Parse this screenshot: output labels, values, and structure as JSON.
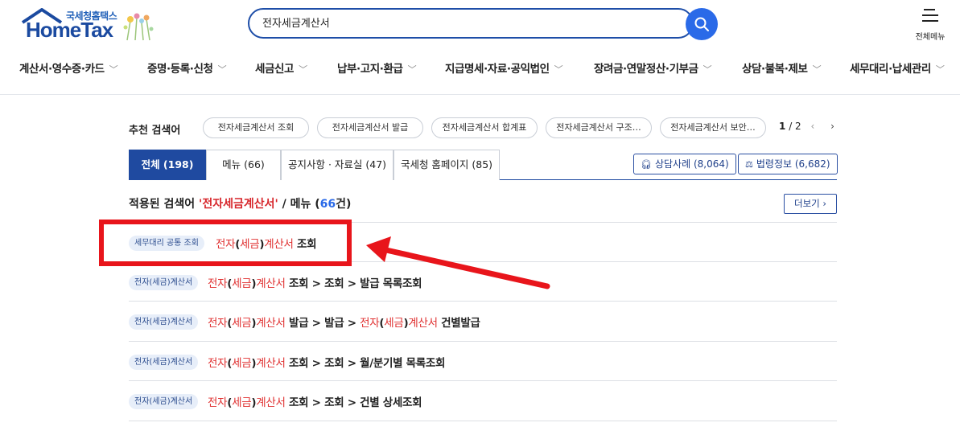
{
  "header": {
    "logo_small": "국세청홈택스",
    "logo_main": "HomeTax",
    "search_value": "전자세금계산서",
    "all_menu_label": "전체메뉴"
  },
  "gnb": [
    "계산서·영수증·카드",
    "증명·등록·신청",
    "세금신고",
    "납부·고지·환급",
    "지급명세·자료·공익법인",
    "장려금·연말정산·기부금",
    "상담·불복·제보",
    "세무대리·납세관리"
  ],
  "recommend": {
    "label": "추천 검색어",
    "chips": [
      "전자세금계산서 조회",
      "전자세금계산서 발급",
      "전자세금계산서 합계표",
      "전자세금계산서 구조…",
      "전자세금계산서 보안…"
    ],
    "page_current": "1",
    "page_total": "/ 2"
  },
  "tabs": [
    {
      "label": "전체 (198)"
    },
    {
      "label": "메뉴 (66)"
    },
    {
      "label": "공지사항 · 자료실 (47)"
    },
    {
      "label": "국세청 홈페이지 (85)"
    }
  ],
  "side_buttons": {
    "consult": "상담사례 (8,064)",
    "law": "법령정보 (6,682)"
  },
  "applied": {
    "prefix": "적용된 검색어 ",
    "query": "'전자세금계산서'",
    "middle": " / 메뉴 (",
    "count": "66",
    "suffix": "건)"
  },
  "more_label": "더보기",
  "results": [
    {
      "badge": "세무대리 공통 조회",
      "hl1": "전자",
      "p1": "(",
      "hl2": "세금",
      "p2": ")",
      "hl3": "계산서",
      "rest": " 조회"
    },
    {
      "badge": "전자(세금)계산서",
      "hl1": "전자",
      "p1": "(",
      "hl2": "세금",
      "p2": ")",
      "hl3": "계산서",
      "rest": " 조회 > 조회 > 발급 목록조회"
    },
    {
      "badge": "전자(세금)계산서",
      "hl1": "전자",
      "p1": "(",
      "hl2": "세금",
      "p2": ")",
      "hl3": "계산서",
      "rest": " 발급 > 발급 > ",
      "hl4": "전자",
      "p3": "(",
      "hl5": "세금",
      "p4": ")",
      "hl6": "계산서",
      "rest2": " 건별발급"
    },
    {
      "badge": "전자(세금)계산서",
      "hl1": "전자",
      "p1": "(",
      "hl2": "세금",
      "p2": ")",
      "hl3": "계산서",
      "rest": " 조회 > 조회 > 월/분기별 목록조회"
    },
    {
      "badge": "전자(세금)계산서",
      "hl1": "전자",
      "p1": "(",
      "hl2": "세금",
      "p2": ")",
      "hl3": "계산서",
      "rest": " 조회 > 조회 > 건별 상세조회"
    }
  ],
  "colors": {
    "brand": "#1f4aa0",
    "highlight": "#e03131",
    "annotation": "#e8151b"
  }
}
